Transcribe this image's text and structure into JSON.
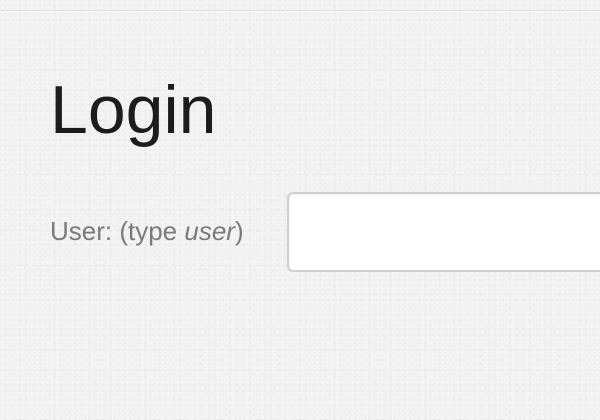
{
  "login": {
    "title": "Login",
    "user_field": {
      "label_prefix": "User: (type ",
      "label_hint": "user",
      "label_suffix": ")",
      "value": "",
      "placeholder": ""
    }
  }
}
